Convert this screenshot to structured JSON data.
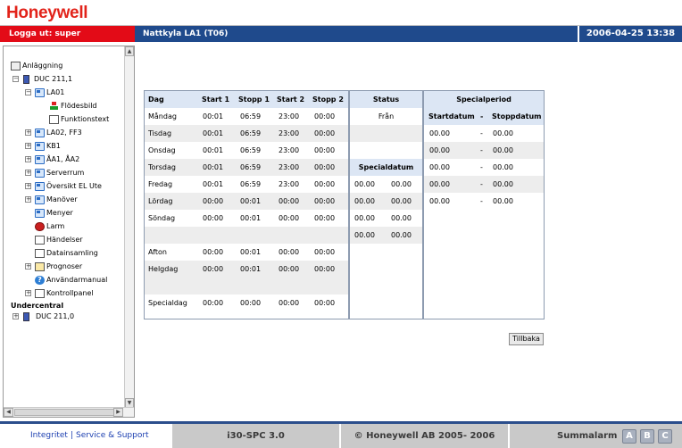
{
  "header": {
    "logo": "Honeywell",
    "logout_label": "Logga ut: super",
    "page_title": "Nattkyla LA1 (T06)",
    "datetime": "2006-04-25 13:38",
    "brand_color": "#e2231a",
    "nav_color": "#1f4a8c"
  },
  "tree": {
    "root_label": "Anläggning",
    "items": [
      {
        "label": "DUC 211,1",
        "icon": "device-icon"
      },
      {
        "label": "LA01",
        "icon": "folder-icon"
      },
      {
        "label": "Flödesbild",
        "icon": "flow-icon"
      },
      {
        "label": "Funktionstext",
        "icon": "doc-icon"
      },
      {
        "label": "LA02, FF3",
        "icon": "folder-icon"
      },
      {
        "label": "KB1",
        "icon": "folder-icon"
      },
      {
        "label": "ÅA1, ÅA2",
        "icon": "folder-icon"
      },
      {
        "label": "Serverrum",
        "icon": "folder-icon"
      },
      {
        "label": "Översikt EL Ute",
        "icon": "folder-icon"
      },
      {
        "label": "Manöver",
        "icon": "folder-icon"
      },
      {
        "label": "Menyer",
        "icon": "folder-icon"
      },
      {
        "label": "Larm",
        "icon": "alarm-icon"
      },
      {
        "label": "Händelser",
        "icon": "doc-icon"
      },
      {
        "label": "Datainsamling",
        "icon": "doc-icon"
      },
      {
        "label": "Prognoser",
        "icon": "weather-icon"
      },
      {
        "label": "Användarmanual",
        "icon": "help-icon"
      },
      {
        "label": "Kontrollpanel",
        "icon": "doc-icon"
      }
    ],
    "section_label": "Undercentral",
    "sub_item": "DUC 211,0"
  },
  "schedule": {
    "headers": {
      "dag": "Dag",
      "start1": "Start 1",
      "stopp1": "Stopp 1",
      "start2": "Start 2",
      "stopp2": "Stopp 2",
      "status": "Status",
      "specialperiod": "Specialperiod",
      "startdatum": "Startdatum",
      "dash": "-",
      "stoppdatum": "Stoppdatum",
      "specialdatum": "Specialdatum"
    },
    "status_value": "Från",
    "rows": [
      {
        "day": "Måndag",
        "start1": "00:01",
        "stopp1": "06:59",
        "start2": "23:00",
        "stopp2": "00:00"
      },
      {
        "day": "Tisdag",
        "start1": "00:01",
        "stopp1": "06:59",
        "start2": "23:00",
        "stopp2": "00:00"
      },
      {
        "day": "Onsdag",
        "start1": "00:01",
        "stopp1": "06:59",
        "start2": "23:00",
        "stopp2": "00:00"
      },
      {
        "day": "Torsdag",
        "start1": "00:01",
        "stopp1": "06:59",
        "start2": "23:00",
        "stopp2": "00:00"
      },
      {
        "day": "Fredag",
        "start1": "00:01",
        "stopp1": "06:59",
        "start2": "23:00",
        "stopp2": "00:00"
      },
      {
        "day": "Lördag",
        "start1": "00:00",
        "stopp1": "00:01",
        "start2": "00:00",
        "stopp2": "00:00"
      },
      {
        "day": "Söndag",
        "start1": "00:00",
        "stopp1": "00:01",
        "start2": "00:00",
        "stopp2": "00:00"
      },
      {
        "day": "Afton",
        "start1": "00:00",
        "stopp1": "00:01",
        "start2": "00:00",
        "stopp2": "00:00"
      },
      {
        "day": "Helgdag",
        "start1": "00:00",
        "stopp1": "00:01",
        "start2": "00:00",
        "stopp2": "00:00"
      },
      {
        "day": "Specialdag",
        "start1": "00:00",
        "stopp1": "00:00",
        "start2": "00:00",
        "stopp2": "00:00"
      }
    ],
    "special_dates": [
      [
        "00.00",
        "00.00"
      ],
      [
        "00.00",
        "00.00"
      ],
      [
        "00.00",
        "00.00"
      ],
      [
        "00.00",
        "00.00"
      ]
    ],
    "special_periods": [
      [
        "00.00",
        "-",
        "00.00"
      ],
      [
        "00.00",
        "-",
        "00.00"
      ],
      [
        "00.00",
        "-",
        "00.00"
      ],
      [
        "00.00",
        "-",
        "00.00"
      ],
      [
        "00.00",
        "-",
        "00.00"
      ]
    ]
  },
  "back_button": "Tillbaka",
  "footer": {
    "integrity_link": "Integritet",
    "separator": "|",
    "support_link": "Service & Support",
    "product": "i30-SPC 3.0",
    "copyright": "© Honeywell AB 2005- 2006",
    "summary_alarm": "Summalarm",
    "alarm_classes": [
      "A",
      "B",
      "C"
    ]
  }
}
